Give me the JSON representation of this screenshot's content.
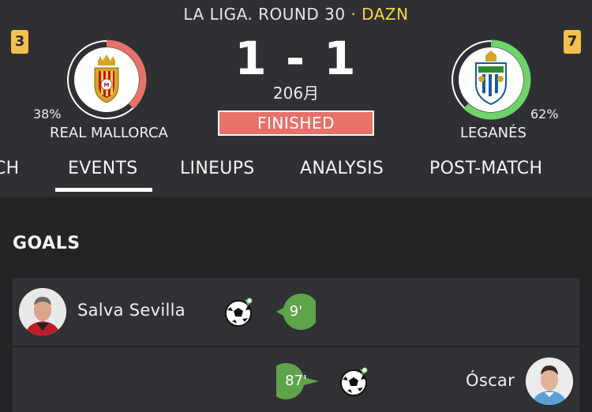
{
  "match": {
    "competition": "LA LIGA. ROUND 30",
    "separator": "·",
    "broadcaster": "DAZN",
    "score": "1 - 1",
    "date": "206月",
    "status": "FINISHED"
  },
  "home": {
    "rank": "3",
    "name": "REAL MALLORCA",
    "percent_label": "38%",
    "percent": 38,
    "ring_color": "#e8716a"
  },
  "away": {
    "rank": "7",
    "name": "LEGANÉS",
    "percent_label": "62%",
    "percent": 62,
    "ring_color": "#6fd36a"
  },
  "tabs": [
    "CH",
    "EVENTS",
    "LINEUPS",
    "ANALYSIS",
    "POST-MATCH"
  ],
  "active_tab": "EVENTS",
  "goals_section": {
    "title": "GOALS",
    "events": [
      {
        "player": "Salva Sevilla",
        "minute": "9'",
        "side": "home",
        "icon": "soccer-ball-icon"
      },
      {
        "player": "Óscar",
        "minute": "87'",
        "side": "away",
        "icon": "soccer-ball-icon"
      }
    ]
  },
  "colors": {
    "header_bg": "#2e3033",
    "page_bg": "#222426",
    "accent_yellow": "#f7d73a",
    "rank_badge": "#f3c14a",
    "finished_badge": "#e8716a",
    "minute_bubble": "#5fa34a"
  }
}
